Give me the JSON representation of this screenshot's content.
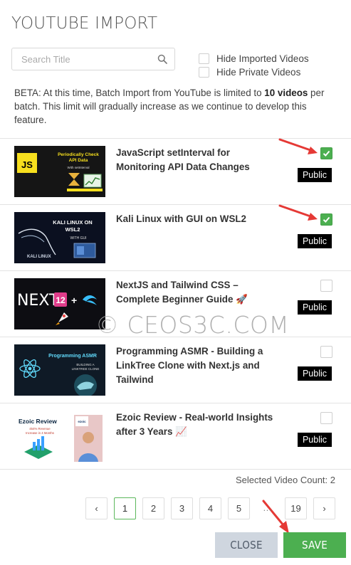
{
  "header": {
    "title": "YOUTUBE IMPORT"
  },
  "search": {
    "placeholder": "Search Title",
    "value": ""
  },
  "options": [
    {
      "label": "Hide Imported Videos",
      "checked": false
    },
    {
      "label": "Hide Private Videos",
      "checked": false
    }
  ],
  "beta": {
    "prefix": "BETA: At this time, Batch Import from YouTube is limited to ",
    "bold": "10 videos",
    "suffix": " per batch. This limit will gradually increase as we continue to develop this feature."
  },
  "videos": [
    {
      "title": "JavaScript setInterval for Monitoring API Data Changes",
      "selected": true,
      "status": "Public",
      "thumb_text": [
        "Periodically Check",
        "API Data",
        "With setInterval",
        "JS"
      ]
    },
    {
      "title": "Kali Linux with GUI on WSL2",
      "selected": true,
      "status": "Public",
      "thumb_text": [
        "KALI LINUX ON",
        "WSL2",
        "WITH GUI",
        "KALI LINUX"
      ]
    },
    {
      "title": "NextJS and Tailwind CSS – Complete Beginner Guide 🚀",
      "selected": false,
      "status": "Public",
      "thumb_text": [
        "NEXT",
        "12",
        "+"
      ]
    },
    {
      "title": "Programming ASMR - Building a LinkTree Clone with Next.js and Tailwind",
      "selected": false,
      "status": "Public",
      "thumb_text": [
        "Programming ASMR",
        "BUILDING A",
        "LINKTREE CLONE"
      ]
    },
    {
      "title": "Ezoic Review - Real-world Insights after 3 Years 📈",
      "selected": false,
      "status": "Public",
      "thumb_text": [
        "Ezoic Review",
        "454% Revenue",
        "Increase in 4 Months",
        "ezoic"
      ]
    }
  ],
  "selected_count": {
    "label": "Selected Video Count: 2"
  },
  "pagination": {
    "prev": "‹",
    "pages": [
      "1",
      "2",
      "3",
      "4",
      "5"
    ],
    "current": "1",
    "ellipsis": "…",
    "last": "19",
    "next": "›"
  },
  "actions": {
    "close_label": "CLOSE",
    "save_label": "SAVE"
  },
  "watermark": {
    "text": "© CEOS3C.COM"
  },
  "colors": {
    "accent_green": "#4caf50",
    "arrow_red": "#e53935",
    "close_bg": "#cfd6df",
    "badge_bg": "#000000"
  }
}
